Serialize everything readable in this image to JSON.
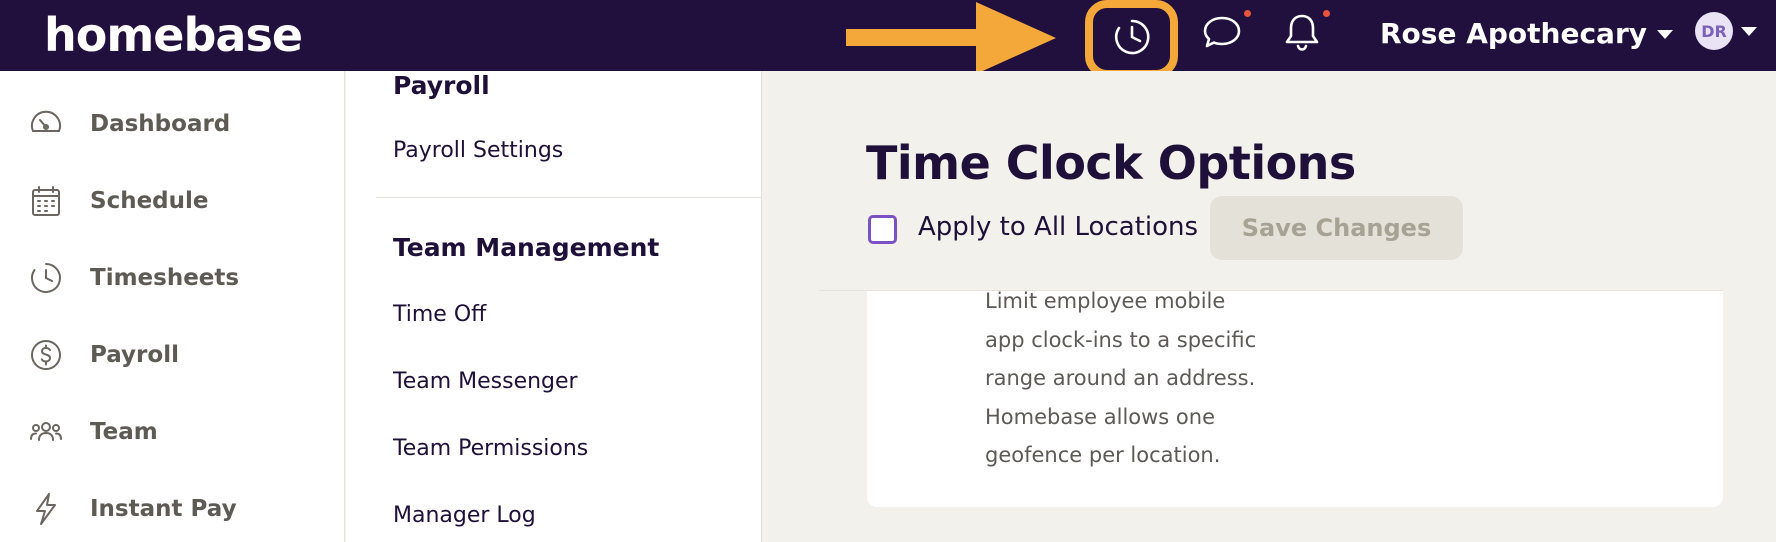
{
  "header": {
    "brand": "homebase",
    "location": "Rose Apothecary",
    "avatar_initials": "DR",
    "icons": [
      "timeclock-icon",
      "chat-icon",
      "bell-icon"
    ],
    "highlight_color": "#f5a83a"
  },
  "sidebar": {
    "items": [
      {
        "label": "Dashboard",
        "icon": "gauge-icon"
      },
      {
        "label": "Schedule",
        "icon": "calendar-icon"
      },
      {
        "label": "Timesheets",
        "icon": "clock-icon"
      },
      {
        "label": "Payroll",
        "icon": "dollar-icon"
      },
      {
        "label": "Team",
        "icon": "team-icon"
      },
      {
        "label": "Instant Pay",
        "icon": "bolt-icon"
      }
    ]
  },
  "settings": {
    "payroll_heading": "Payroll",
    "payroll_links": [
      "Payroll Settings"
    ],
    "team_heading": "Team Management",
    "team_links": [
      "Time Off",
      "Team Messenger",
      "Team Permissions",
      "Manager Log"
    ]
  },
  "main": {
    "title": "Time Clock Options",
    "apply_all_label": "Apply to All Locations",
    "apply_all_checked": false,
    "save_label": "Save Changes",
    "description_lines": [
      "Limit employee mobile",
      "app clock-ins to a specific",
      "range around an address.",
      "Homebase allows one",
      "geofence per location."
    ]
  }
}
